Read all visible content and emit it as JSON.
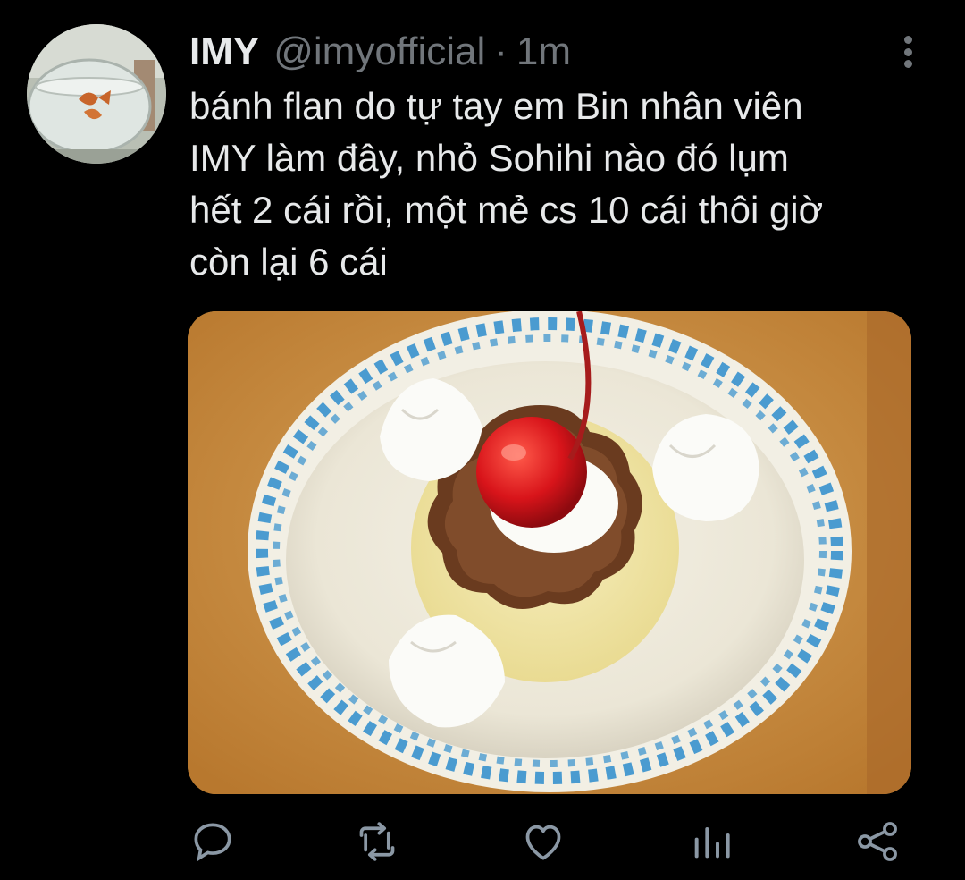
{
  "tweet": {
    "display_name": "IMY",
    "handle": "@imyofficial",
    "separator": "·",
    "timestamp": "1m",
    "text": "bánh flan do tự tay em Bin nhân viên\nIMY làm đây, nhỏ Sohihi nào đó lụm\nhết 2 cái rồi, một mẻ cs 10 cái thôi giờ\ncòn lại 6 cái"
  },
  "icons": {
    "more": "more-vertical-icon",
    "reply": "reply-icon",
    "retweet": "retweet-icon",
    "like": "heart-icon",
    "analytics": "analytics-icon",
    "share": "share-icon"
  },
  "colors": {
    "background": "#000000",
    "text": "#e7e9ea",
    "secondary": "#71767b",
    "action_icon": "#8b98a5"
  }
}
